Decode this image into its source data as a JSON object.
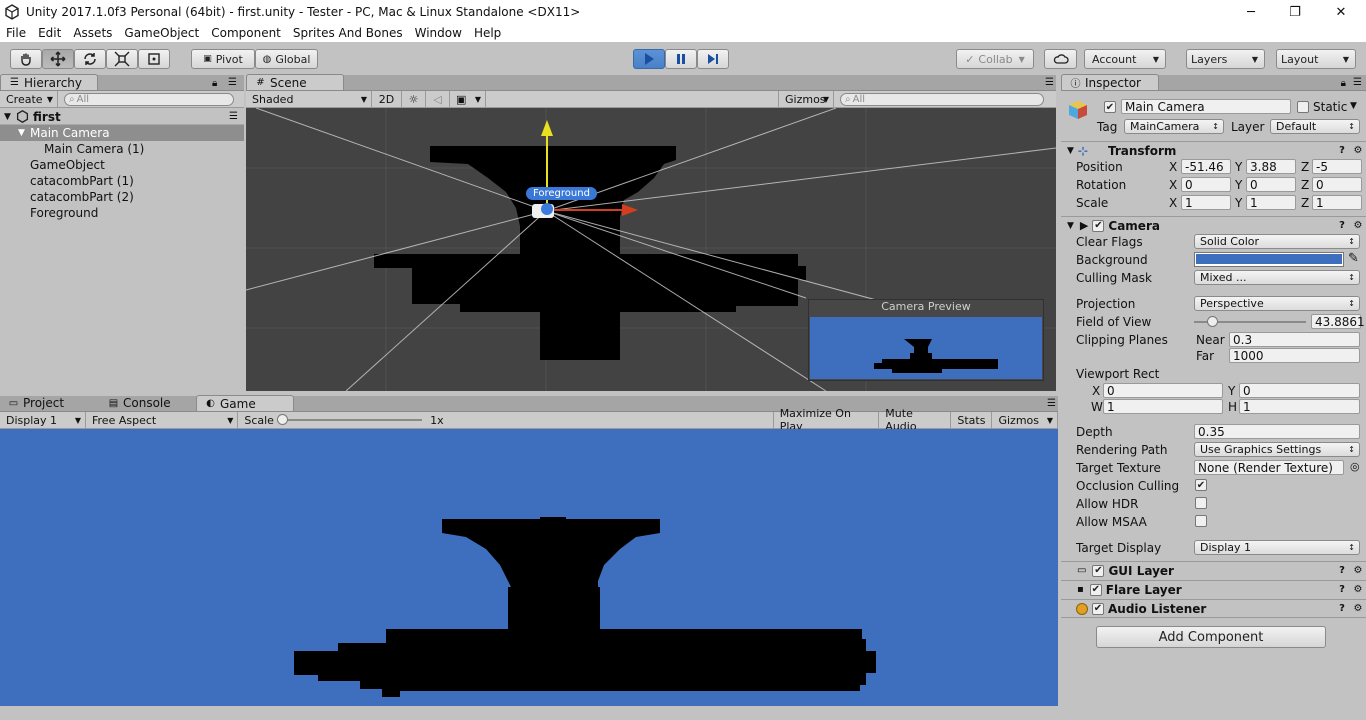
{
  "window": {
    "title": "Unity 2017.1.0f3 Personal (64bit) - first.unity - Tester - PC, Mac & Linux Standalone <DX11>",
    "minimize": "─",
    "maximize": "❐",
    "close": "✕"
  },
  "menu": [
    "File",
    "Edit",
    "Assets",
    "GameObject",
    "Component",
    "Sprites And Bones",
    "Window",
    "Help"
  ],
  "toolbar": {
    "pivot": "Pivot",
    "global": "Global",
    "collab": "Collab",
    "account": "Account",
    "layers": "Layers",
    "layout": "Layout"
  },
  "hierarchy": {
    "tab": "Hierarchy",
    "create": "Create",
    "search_placeholder": "All",
    "scene": "first",
    "items": [
      {
        "label": "Main Camera",
        "indent": 1,
        "selected": true,
        "expand": "▼"
      },
      {
        "label": "Main Camera (1)",
        "indent": 2
      },
      {
        "label": "GameObject",
        "indent": 1
      },
      {
        "label": "catacombPart (1)",
        "indent": 1
      },
      {
        "label": "catacombPart (2)",
        "indent": 1
      },
      {
        "label": "Foreground",
        "indent": 1
      }
    ]
  },
  "scene": {
    "tab": "Scene",
    "shading": "Shaded",
    "mode2d": "2D",
    "gizmos": "Gizmos",
    "search_placeholder": "All",
    "label": "Foreground",
    "preview_title": "Camera Preview"
  },
  "bottom": {
    "tabs": [
      "Project",
      "Console",
      "Game"
    ],
    "display": "Display 1",
    "aspect": "Free Aspect",
    "scale_label": "Scale",
    "scale_value": "1x",
    "buttons": [
      "Maximize On Play",
      "Mute Audio",
      "Stats",
      "Gizmos"
    ]
  },
  "colors": {
    "game_bg": "#3e6fbf",
    "scene_bg": "#434343",
    "background_swatch": "#3e6fbf"
  },
  "inspector": {
    "tab": "Inspector",
    "name": "Main Camera",
    "static": "Static",
    "tag_label": "Tag",
    "tag": "MainCamera",
    "layer_label": "Layer",
    "layer": "Default",
    "transform": {
      "title": "Transform",
      "rows": [
        {
          "label": "Position",
          "x": "-51.46",
          "y": "3.88",
          "z": "-5"
        },
        {
          "label": "Rotation",
          "x": "0",
          "y": "0",
          "z": "0"
        },
        {
          "label": "Scale",
          "x": "1",
          "y": "1",
          "z": "1"
        }
      ]
    },
    "camera": {
      "title": "Camera",
      "clear_flags_label": "Clear Flags",
      "clear_flags": "Solid Color",
      "background_label": "Background",
      "culling_mask_label": "Culling Mask",
      "culling_mask": "Mixed ...",
      "projection_label": "Projection",
      "projection": "Perspective",
      "fov_label": "Field of View",
      "fov": "43.8861",
      "fov_fraction": 0.16,
      "clipping_label": "Clipping Planes",
      "near_label": "Near",
      "near": "0.3",
      "far_label": "Far",
      "far": "1000",
      "viewport_label": "Viewport Rect",
      "vx": "0",
      "vy": "0",
      "vw": "1",
      "vh": "1",
      "depth_label": "Depth",
      "depth": "0.35",
      "rendering_path_label": "Rendering Path",
      "rendering_path": "Use Graphics Settings",
      "target_texture_label": "Target Texture",
      "target_texture": "None (Render Texture)",
      "occlusion_label": "Occlusion Culling",
      "hdr_label": "Allow HDR",
      "msaa_label": "Allow MSAA",
      "target_display_label": "Target Display",
      "target_display": "Display 1"
    },
    "components": [
      "GUI Layer",
      "Flare Layer",
      "Audio Listener"
    ],
    "add_component": "Add Component"
  }
}
